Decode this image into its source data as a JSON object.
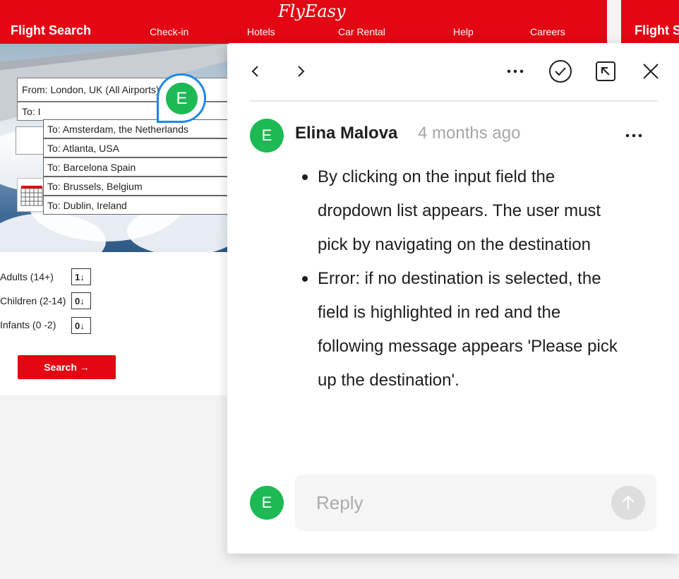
{
  "prototype": {
    "logo": "FlyEasy",
    "brand": "Flight Search",
    "brand_right": "Flight Search",
    "nav": [
      {
        "label": "Check-in"
      },
      {
        "label": "Hotels"
      },
      {
        "label": "Car Rental"
      },
      {
        "label": "Help"
      },
      {
        "label": "Careers"
      }
    ],
    "from_value": "From: London, UK (All Airports)",
    "to_value": "To: I",
    "dropdown": [
      "To: Amsterdam, the Netherlands",
      "To: Atlanta, USA",
      "To: Barcelona Spain",
      "To: Brussels, Belgium",
      "To: Dublin, Ireland"
    ],
    "passengers": [
      {
        "label": "Adults (14+)",
        "value": "1↓"
      },
      {
        "label": "Children (2-14)",
        "value": "0↓"
      },
      {
        "label": "Infants (0 -2)",
        "value": "0↓"
      }
    ],
    "search_label": "Search →",
    "pin_initial": "E",
    "brand_color": "#e30613"
  },
  "panel": {
    "author_initial": "E",
    "author": "Elina Malova",
    "time": "4 months ago",
    "bullets": [
      "By clicking on the input field the dropdown list appears. The user must pick by navigating on the destination",
      "Error: if no destination is selected, the field is highlighted in red and the following message appears 'Please pick up the destination'."
    ],
    "reply_placeholder": "Reply",
    "reply_initial": "E",
    "avatar_color": "#1db954",
    "pin_ring_color": "#1e88e5"
  }
}
